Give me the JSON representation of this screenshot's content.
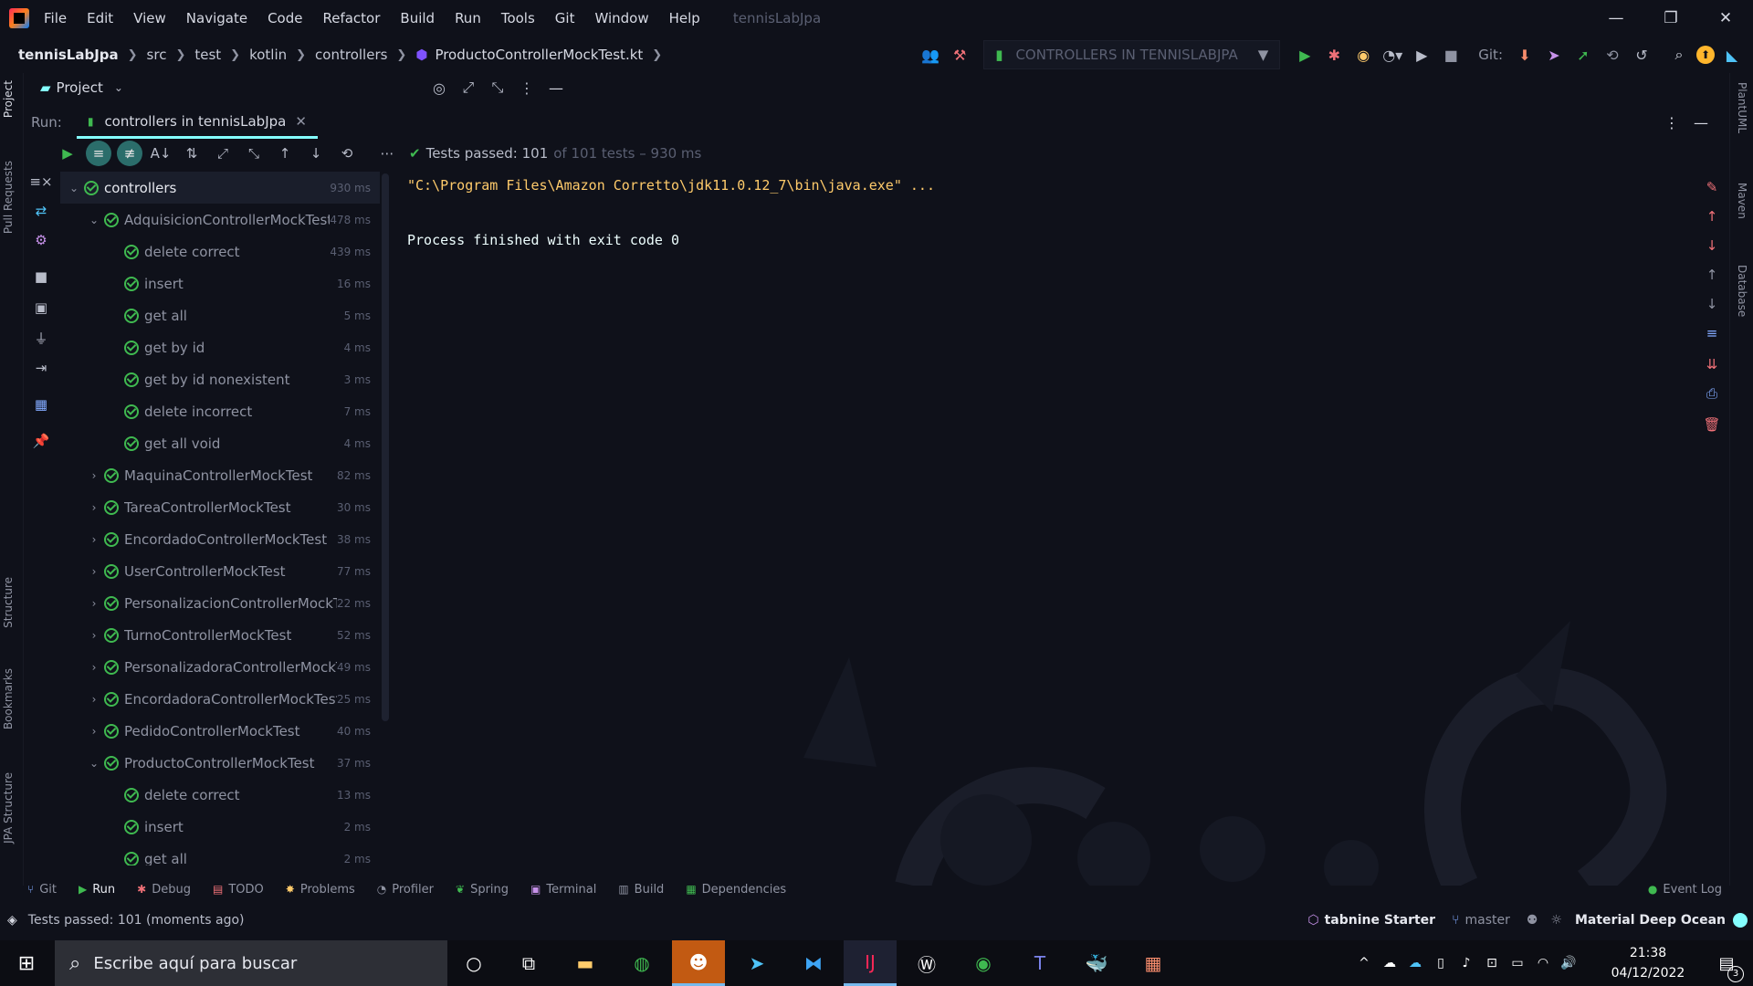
{
  "window": {
    "menu": [
      "File",
      "Edit",
      "View",
      "Navigate",
      "Code",
      "Refactor",
      "Build",
      "Run",
      "Tools",
      "Git",
      "Window",
      "Help"
    ],
    "project_title": "tennisLabJpa",
    "controls": [
      "—",
      "❐",
      "✕"
    ]
  },
  "breadcrumb": {
    "project": "tennisLabJpa",
    "parts": [
      "src",
      "test",
      "kotlin",
      "controllers"
    ],
    "file": "ProductoControllerMockTest.kt"
  },
  "toolbar": {
    "run_config": "CONTROLLERS IN TENNISLABJPA",
    "git_label": "Git:"
  },
  "project_panel": {
    "title": "Project"
  },
  "run_panel": {
    "run_label": "Run:",
    "tab_label": "controllers in tennisLabJpa",
    "tests_passed": "Tests passed: 101",
    "tests_detail": "of 101 tests – 930 ms"
  },
  "tree": [
    {
      "label": "controllers",
      "time": "930 ms",
      "level": 0,
      "chevron": "v",
      "selected": true
    },
    {
      "label": "AdquisicionControllerMockTest",
      "time": "478 ms",
      "level": 1,
      "chevron": "v"
    },
    {
      "label": "delete correct",
      "time": "439 ms",
      "level": 2,
      "chevron": ""
    },
    {
      "label": "insert",
      "time": "16 ms",
      "level": 2,
      "chevron": ""
    },
    {
      "label": "get all",
      "time": "5 ms",
      "level": 2,
      "chevron": ""
    },
    {
      "label": "get by id",
      "time": "4 ms",
      "level": 2,
      "chevron": ""
    },
    {
      "label": "get by id nonexistent",
      "time": "3 ms",
      "level": 2,
      "chevron": ""
    },
    {
      "label": "delete incorrect",
      "time": "7 ms",
      "level": 2,
      "chevron": ""
    },
    {
      "label": "get all void",
      "time": "4 ms",
      "level": 2,
      "chevron": ""
    },
    {
      "label": "MaquinaControllerMockTest",
      "time": "82 ms",
      "level": 1,
      "chevron": ">"
    },
    {
      "label": "TareaControllerMockTest",
      "time": "30 ms",
      "level": 1,
      "chevron": ">"
    },
    {
      "label": "EncordadoControllerMockTest",
      "time": "38 ms",
      "level": 1,
      "chevron": ">"
    },
    {
      "label": "UserControllerMockTest",
      "time": "77 ms",
      "level": 1,
      "chevron": ">"
    },
    {
      "label": "PersonalizacionControllerMockTest",
      "time": "22 ms",
      "level": 1,
      "chevron": ">"
    },
    {
      "label": "TurnoControllerMockTest",
      "time": "52 ms",
      "level": 1,
      "chevron": ">"
    },
    {
      "label": "PersonalizadoraControllerMockTest",
      "time": "49 ms",
      "level": 1,
      "chevron": ">"
    },
    {
      "label": "EncordadoraControllerMockTest",
      "time": "25 ms",
      "level": 1,
      "chevron": ">"
    },
    {
      "label": "PedidoControllerMockTest",
      "time": "40 ms",
      "level": 1,
      "chevron": ">"
    },
    {
      "label": "ProductoControllerMockTest",
      "time": "37 ms",
      "level": 1,
      "chevron": "v"
    },
    {
      "label": "delete correct",
      "time": "13 ms",
      "level": 2,
      "chevron": ""
    },
    {
      "label": "insert",
      "time": "2 ms",
      "level": 2,
      "chevron": ""
    },
    {
      "label": "get all",
      "time": "2 ms",
      "level": 2,
      "chevron": ""
    }
  ],
  "console": {
    "line1": "\"C:\\Program Files\\Amazon Corretto\\jdk11.0.12_7\\bin\\java.exe\" ...",
    "line2": "Process finished with exit code 0"
  },
  "left_vertical_tabs": [
    "Project",
    "Pull Requests",
    "Structure",
    "Bookmarks",
    "JPA Structure"
  ],
  "right_vertical_tabs": [
    "PlantUML",
    "Maven",
    "Database"
  ],
  "bottom_tabs": [
    "Git",
    "Run",
    "Debug",
    "TODO",
    "Problems",
    "Profiler",
    "Spring",
    "Terminal",
    "Build",
    "Dependencies"
  ],
  "event_log": "Event Log",
  "status": {
    "message": "Tests passed: 101 (moments ago)",
    "tabnine": "tabnine Starter",
    "branch": "master",
    "theme": "Material Deep Ocean"
  },
  "taskbar": {
    "search_placeholder": "Escribe aquí para buscar",
    "time": "21:38",
    "date": "04/12/2022",
    "notification_count": "3"
  },
  "colors": {
    "background": "#0f111a",
    "accent": "#84ffff",
    "success": "#3fb950",
    "console_path": "#ffcb6b"
  }
}
